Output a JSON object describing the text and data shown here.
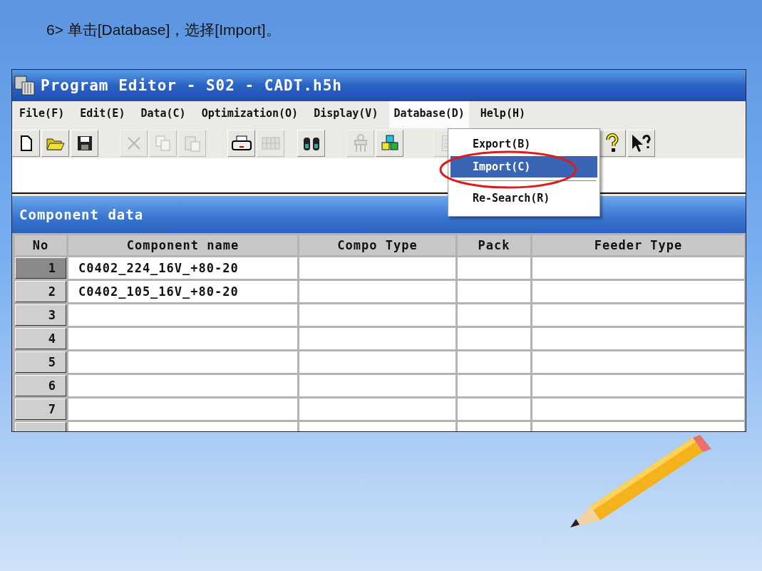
{
  "caption": "6> 单击[Database]，选择[Import]。",
  "window": {
    "title": "Program Editor - S02 - CADT.h5h"
  },
  "menu": [
    {
      "label": "File(F)",
      "selected": false
    },
    {
      "label": "Edit(E)",
      "selected": false
    },
    {
      "label": "Data(C)",
      "selected": false
    },
    {
      "label": "Optimization(O)",
      "selected": false
    },
    {
      "label": "Display(V)",
      "selected": false
    },
    {
      "label": "Database(D)",
      "selected": true
    },
    {
      "label": "Help(H)",
      "selected": false
    }
  ],
  "toolbar": [
    [
      {
        "disabled": false
      },
      {
        "disabled": false
      },
      {
        "disabled": false
      }
    ],
    [
      {
        "disabled": true
      },
      {
        "disabled": true
      },
      {
        "disabled": true
      }
    ],
    [
      {
        "disabled": false
      },
      {
        "disabled": true
      }
    ],
    [
      {
        "disabled": false
      }
    ],
    [
      {
        "disabled": true
      },
      {
        "disabled": false
      }
    ],
    [
      {
        "disabled": true
      }
    ],
    [
      {
        "disabled": false
      },
      {
        "disabled": false
      }
    ]
  ],
  "dropdown": [
    {
      "kind": "item",
      "label": "Export(B)",
      "selected": false
    },
    {
      "kind": "item",
      "label": "Import(C)",
      "selected": true
    },
    {
      "kind": "separator"
    },
    {
      "kind": "item",
      "label": "Re-Search(R)",
      "selected": false
    }
  ],
  "panel": {
    "title": "Component data"
  },
  "table": {
    "columns": [
      "No",
      "Component name",
      "Compo Type",
      "Pack",
      "Feeder Type"
    ],
    "rows": [
      {
        "no": "1",
        "name": "C0402_224_16V_+80-20",
        "selected": true
      },
      {
        "no": "2",
        "name": "C0402_105_16V_+80-20",
        "selected": false
      },
      {
        "no": "3",
        "selected": false
      },
      {
        "no": "4",
        "selected": false
      },
      {
        "no": "5",
        "selected": false
      },
      {
        "no": "6",
        "selected": false
      },
      {
        "no": "7",
        "selected": false
      }
    ]
  }
}
